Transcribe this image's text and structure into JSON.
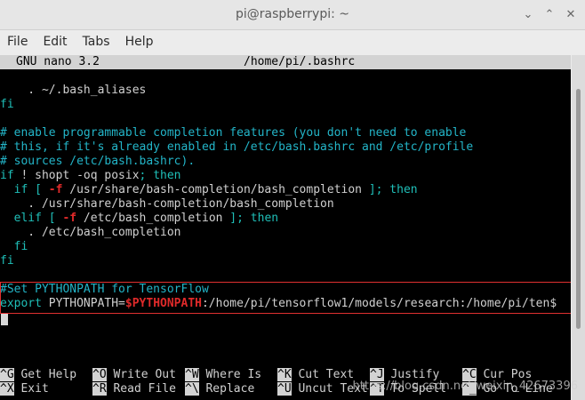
{
  "window": {
    "title": "pi@raspberrypi: ~",
    "minimize_glyph": "⌄",
    "maximize_glyph": "⌃",
    "close_glyph": "✕"
  },
  "menu": [
    "File",
    "Edit",
    "Tabs",
    "Help"
  ],
  "nano": {
    "version": "GNU nano 3.2",
    "filename": "/home/pi/.bashrc"
  },
  "code": {
    "l1": "    . ~/.bash_aliases",
    "l2": "fi",
    "l3": "# enable programmable completion features (you don't need to enable",
    "l4": "# this, if it's already enabled in /etc/bash.bashrc and /etc/profile",
    "l5": "# sources /etc/bash.bashrc).",
    "l6_kw": "if",
    "l6_mid": " ! shopt -oq posix",
    "l6_end": "; then",
    "l7_kw": "  if [",
    "l7_flag": " -f",
    "l7_path": " /usr/share/bash-completion/bash_completion",
    "l7_end": " ]; then",
    "l8": "    . /usr/share/bash-completion/bash_completion",
    "l9_kw": "  elif [",
    "l9_flag": " -f",
    "l9_path": " /etc/bash_completion",
    "l9_end": " ]; then",
    "l10": "    . /etc/bash_completion",
    "l11": "  fi",
    "l12": "fi",
    "l13": "#Set PYTHONPATH for TensorFlow",
    "l14_kw": "export",
    "l14_var": " PYTHONPATH=",
    "l14_ref": "$PYTHONPATH",
    "l14_rest": ":/home/pi/tensorflow1/models/research:/home/pi/ten$"
  },
  "shortcuts": [
    {
      "key": "^G",
      "label": " Get Help"
    },
    {
      "key": "^O",
      "label": " Write Out"
    },
    {
      "key": "^W",
      "label": " Where Is"
    },
    {
      "key": "^K",
      "label": " Cut Text"
    },
    {
      "key": "^J",
      "label": " Justify"
    },
    {
      "key": "^C",
      "label": " Cur Pos"
    },
    {
      "key": "^X",
      "label": " Exit"
    },
    {
      "key": "^R",
      "label": " Read File"
    },
    {
      "key": "^\\",
      "label": " Replace"
    },
    {
      "key": "^U",
      "label": " Uncut Text"
    },
    {
      "key": "^T",
      "label": " To Spell"
    },
    {
      "key": "^_",
      "label": " Go To Line"
    }
  ],
  "watermark": "https://blog.csdn.net/weixin_42673396"
}
